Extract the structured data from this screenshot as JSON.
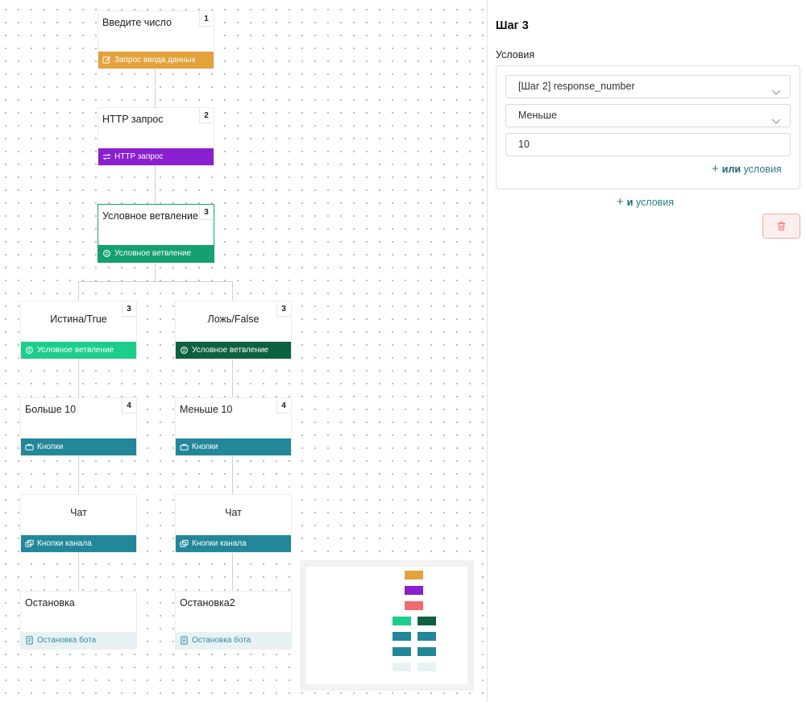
{
  "flow": {
    "nodes": [
      {
        "id": "n1",
        "title": "Введите число",
        "number": "1",
        "footer": "Запрос ввода данных",
        "icon": "edit-icon",
        "color": "#e4a23b"
      },
      {
        "id": "n2",
        "title": "HTTP запрос",
        "number": "2",
        "footer": "HTTP запрос",
        "icon": "swap-arrows-icon",
        "color": "#8a1fd1"
      },
      {
        "id": "n3",
        "title": "Условное ветвление",
        "number": "3",
        "footer": "Условное ветвление",
        "icon": "branch-icon",
        "color": "#14a06f"
      },
      {
        "id": "n4",
        "title": "Истина/True",
        "number": "3",
        "footer": "Условное ветвление",
        "icon": "branch-icon",
        "color": "#1cce8b"
      },
      {
        "id": "n5",
        "title": "Ложь/False",
        "number": "3",
        "footer": "Условное ветвление",
        "icon": "branch-icon",
        "color": "#0c6141"
      },
      {
        "id": "n6",
        "title": "Больше 10",
        "number": "4",
        "footer": "Кнопки",
        "icon": "buttons-icon",
        "color": "#23879a"
      },
      {
        "id": "n7",
        "title": "Меньше 10",
        "number": "4",
        "footer": "Кнопки",
        "icon": "buttons-icon",
        "color": "#23879a"
      },
      {
        "id": "n8",
        "title": "Чат",
        "footer": "Кнопки канала",
        "icon": "channel-buttons-icon",
        "color": "#23879a"
      },
      {
        "id": "n9",
        "title": "Чат",
        "footer": "Кнопки канала",
        "icon": "channel-buttons-icon",
        "color": "#23879a"
      },
      {
        "id": "n10",
        "title": "Остановка",
        "footer": "Остановка бота",
        "icon": "document-icon",
        "color": "#e7f2f4"
      },
      {
        "id": "n11",
        "title": "Остановка2",
        "footer": "Остановка бота",
        "icon": "document-icon",
        "color": "#e7f2f4"
      }
    ]
  },
  "panel": {
    "title": "Шаг 3",
    "conditions_label": "Условия",
    "variable": "[Шаг 2] response_number",
    "operator": "Меньше",
    "value": "10",
    "or_link": {
      "bold": "или",
      "text": "условия"
    },
    "and_link": {
      "bold": "и",
      "text": "условия"
    },
    "delete_icon": "trash-icon"
  },
  "colors": {
    "orange": "#e4a23b",
    "purple": "#8a1fd1",
    "green": "#14a06f",
    "light_green": "#1cce8b",
    "dark_green": "#0c6141",
    "teal": "#23879a",
    "danger": "#f06b6b"
  }
}
